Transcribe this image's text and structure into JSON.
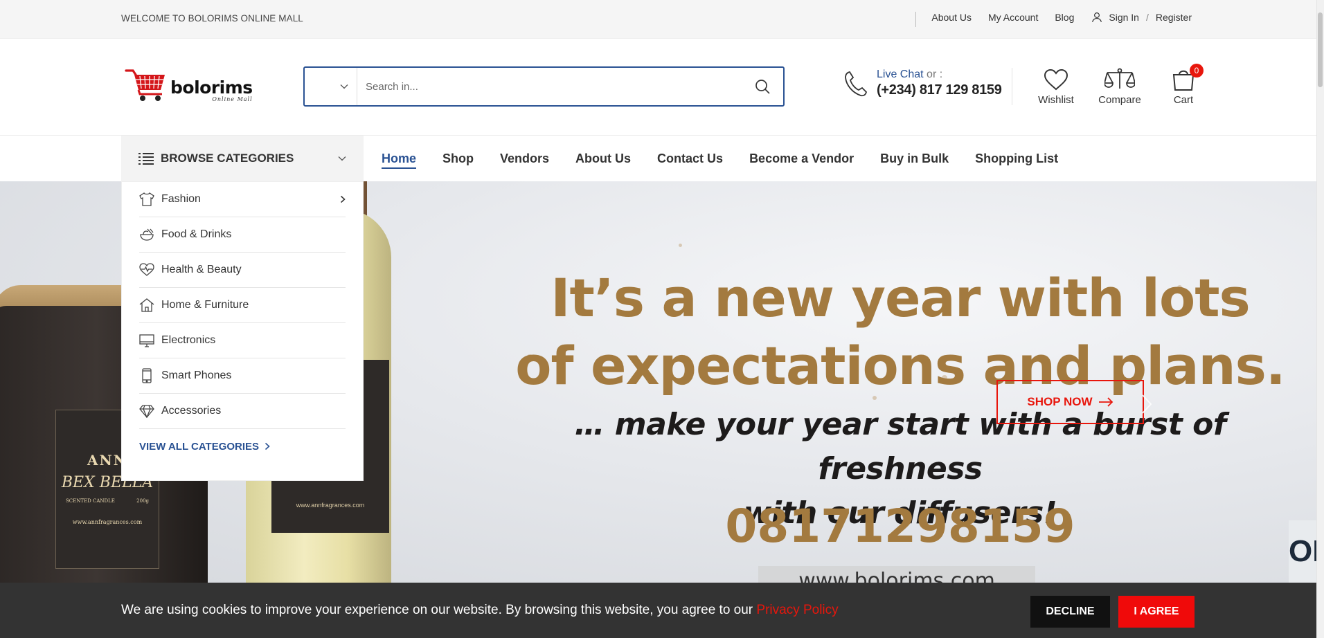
{
  "topbar": {
    "welcome": "WELCOME TO BOLORIMS ONLINE MALL",
    "links": [
      "About Us",
      "My Account",
      "Blog"
    ],
    "sign_in": "Sign In",
    "separator": "/",
    "register": "Register"
  },
  "header": {
    "logo_brand": "bolorims",
    "logo_tagline": "Online Mall",
    "search": {
      "placeholder": "Search in..."
    },
    "contact": {
      "live_chat": "Live Chat",
      "or": "or :",
      "phone": "(+234) 817 129 8159"
    },
    "icons": {
      "wishlist": "Wishlist",
      "compare": "Compare",
      "cart": "Cart",
      "cart_count": "0"
    }
  },
  "nav": {
    "browse_label": "BROWSE CATEGORIES",
    "links": [
      "Home",
      "Shop",
      "Vendors",
      "About Us",
      "Contact Us",
      "Become a Vendor",
      "Buy in Bulk",
      "Shopping List"
    ],
    "active": "Home"
  },
  "categories": {
    "items": [
      {
        "label": "Fashion",
        "icon": "tshirt-icon",
        "has_sub": true
      },
      {
        "label": "Food & Drinks",
        "icon": "food-bowl-icon",
        "has_sub": false
      },
      {
        "label": "Health & Beauty",
        "icon": "heart-pulse-icon",
        "has_sub": false
      },
      {
        "label": "Home & Furniture",
        "icon": "house-icon",
        "has_sub": false
      },
      {
        "label": "Electronics",
        "icon": "monitor-icon",
        "has_sub": false
      },
      {
        "label": "Smart Phones",
        "icon": "phone-device-icon",
        "has_sub": false
      },
      {
        "label": "Accessories",
        "icon": "diamond-icon",
        "has_sub": false
      }
    ],
    "view_all": "VIEW ALL CATEGORIES"
  },
  "hero": {
    "headline_1": "It’s a new year with lots",
    "headline_2": "of expectations and plans.",
    "sub_1": "… make your year start with a burst of freshness",
    "sub_2": "with our diffusers!",
    "phone": "08171298159",
    "website": "www.bolorims.com",
    "edge_text": "OR",
    "cta": "SHOP NOW",
    "candle_label_1": "ANN",
    "candle_label_2": "BEX BELLA",
    "candle_label_3a": "SCENTED CANDLE",
    "candle_label_3b": "200g",
    "product_url": "www.annfragrances.com"
  },
  "cookie": {
    "message": "We are using cookies to improve your experience on our website. By browsing this website, you agree to our ",
    "policy_link": "Privacy Policy",
    "decline": "DECLINE",
    "agree": "I AGREE"
  },
  "colors": {
    "brand_blue": "#2a5293",
    "accent_red": "#e8160c",
    "hero_gold": "#a37a3f",
    "cookie_bg": "#333333"
  }
}
